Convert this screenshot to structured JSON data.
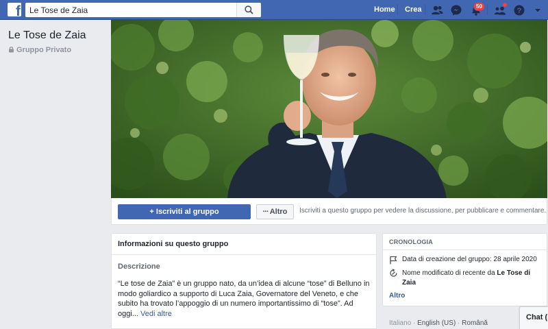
{
  "topbar": {
    "search_value": "Le Tose de Zaia",
    "home_label": "Home",
    "create_label": "Crea",
    "notifications_count": "50",
    "accent_color": "#4267b2"
  },
  "group": {
    "name": "Le Tose de Zaia",
    "privacy": "Gruppo Privato"
  },
  "actions": {
    "join_label": "Iscriviti al gruppo",
    "other_label": "Altro",
    "hint": "Iscriviti a questo gruppo per vedere la discussione, per pubblicare e commentare."
  },
  "info": {
    "title": "Informazioni su questo gruppo",
    "description_title": "Descrizione",
    "description": "“Le tose de Zaia” è un gruppo nato, da un’idea di alcune “tose” di Belluno in modo goliardico a supporto di Luca Zaia, Governatore del Veneto, e che subito ha trovato l’appoggio di un numero importantissimo di “tose”. Ad oggi...",
    "see_more": "Vedi altre"
  },
  "timeline": {
    "title": "CRONOLOGIA",
    "created": "Data di creazione del gruppo: 28 aprile 2020",
    "renamed_prefix": "Nome modificato di recente da",
    "renamed_name": "Le Tose di Zaia",
    "more": "Altro"
  },
  "footer": {
    "languages": [
      "Italiano",
      "English (US)",
      "Română"
    ]
  },
  "chat": {
    "label": "Chat (1"
  }
}
